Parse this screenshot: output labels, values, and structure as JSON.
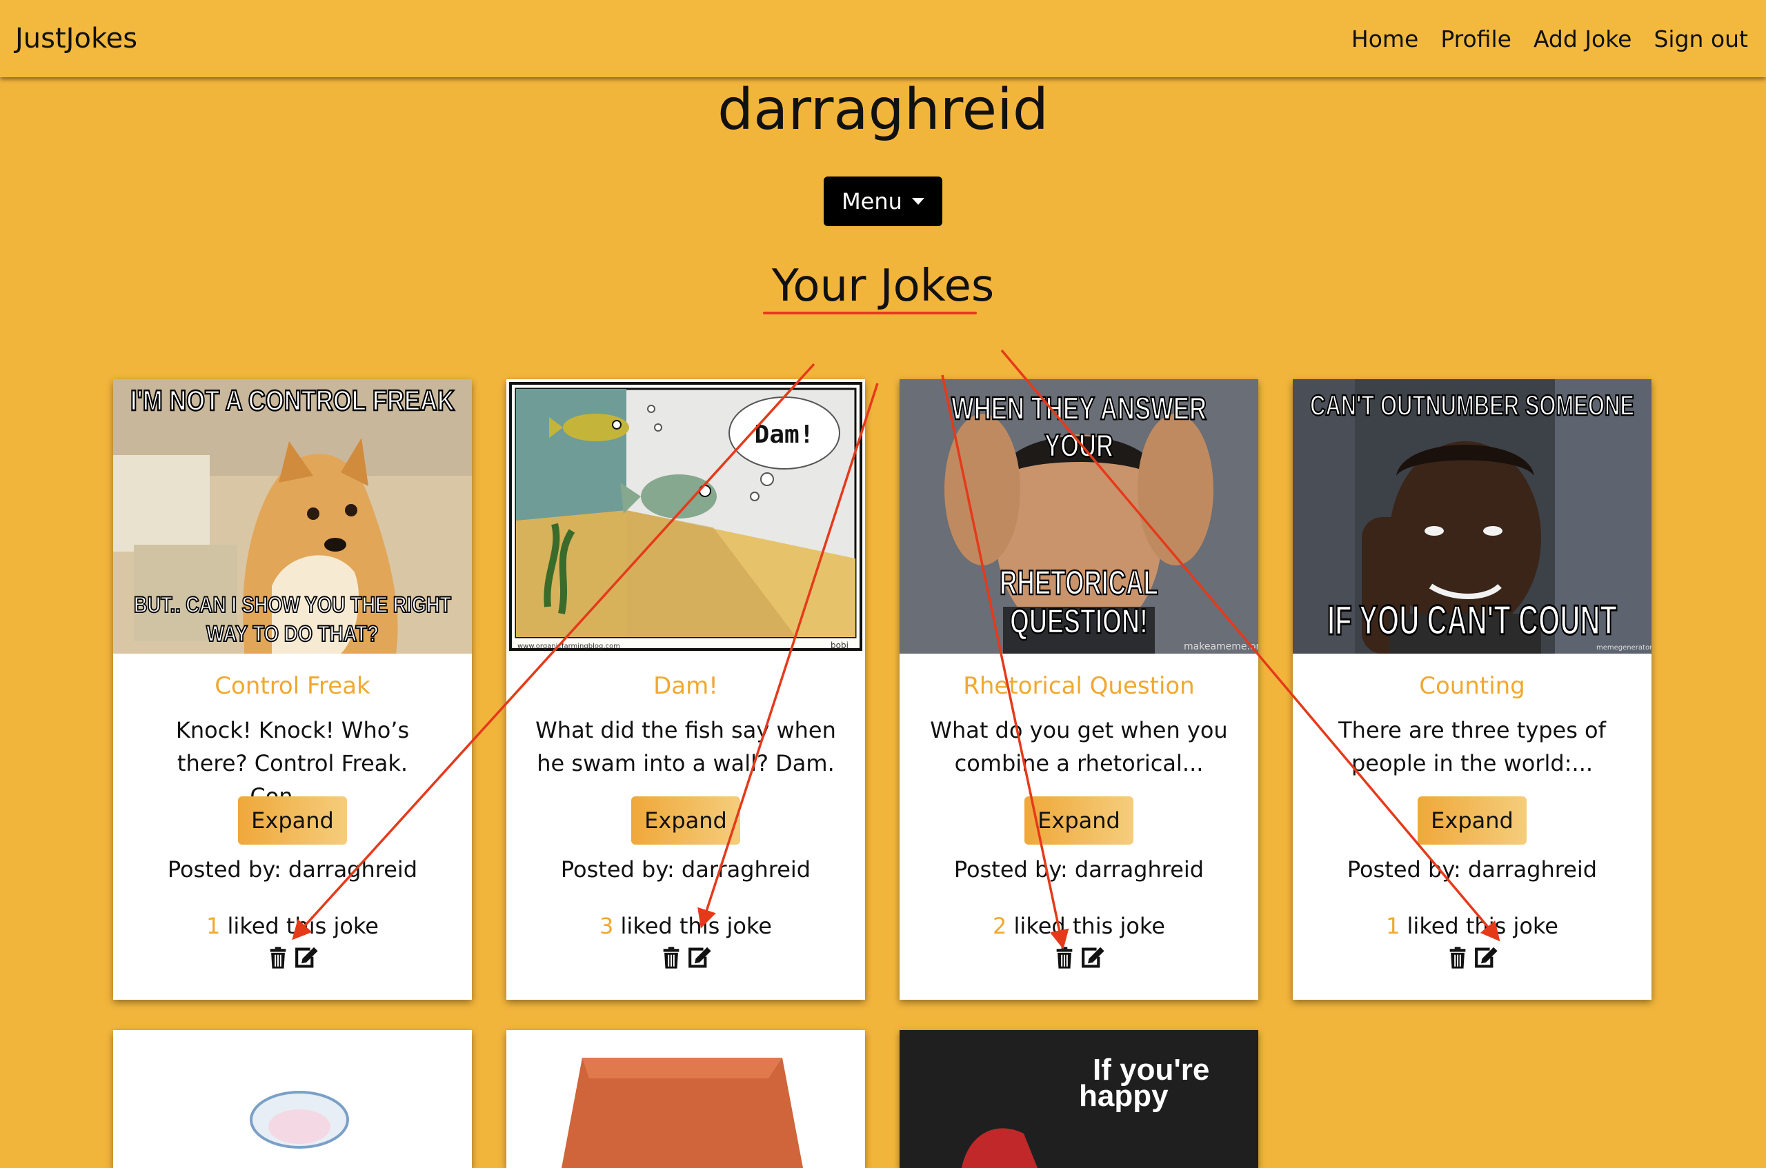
{
  "navbar": {
    "brand": "JustJokes",
    "links": [
      "Home",
      "Profile",
      "Add Joke",
      "Sign out"
    ]
  },
  "profile": {
    "username": "darraghreid",
    "menu_label": "Menu"
  },
  "section_title": "Your Jokes",
  "jokes": [
    {
      "meme_top": "I'M NOT A CONTROL FREAK",
      "meme_bottom": [
        "BUT.. CAN I SHOW YOU THE RIGHT",
        "WAY TO DO THAT?"
      ],
      "title": "Control Freak",
      "text": "Knock! Knock! Who’s there? Control Freak. Con......",
      "expand_label": "Expand",
      "poster": "Posted by: darraghreid",
      "like_count": "1",
      "like_text": "liked this joke"
    },
    {
      "meme_bubble": "Dam!",
      "meme_credit": "www.organicfarmingblog.com",
      "meme_sig": "bobi",
      "title": "Dam!",
      "text": "What did the fish say when he swam into a wall? Dam.",
      "expand_label": "Expand",
      "poster": "Posted by: darraghreid",
      "like_count": "3",
      "like_text": "liked this joke"
    },
    {
      "meme_top": [
        "WHEN THEY ANSWER",
        "YOUR"
      ],
      "meme_bottom": [
        "RHETORICAL",
        "QUESTION!"
      ],
      "meme_credit": "makeameme.org",
      "title": "Rhetorical Question",
      "text": "What do you get when you combine a rhetorical...",
      "expand_label": "Expand",
      "poster": "Posted by: darraghreid",
      "like_count": "2",
      "like_text": "liked this joke"
    },
    {
      "meme_top": "CAN'T OUTNUMBER SOMEONE",
      "meme_bottom": "IF YOU CAN'T COUNT",
      "meme_credit": "memegenerator.net",
      "title": "Counting",
      "text": "There are three types of people in the world:...",
      "expand_label": "Expand",
      "poster": "Posted by: darraghreid",
      "like_count": "1",
      "like_text": "liked this joke"
    }
  ],
  "lower_cards": [
    {
      "meme_text": [
        "If you're",
        "happy"
      ]
    }
  ],
  "icons": {
    "delete": "trash-icon",
    "edit": "edit-icon"
  },
  "colors": {
    "background": "#f2b53c",
    "joke_title": "#f0a830",
    "annotation": "#e53a1a"
  }
}
